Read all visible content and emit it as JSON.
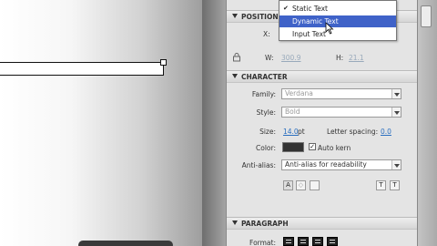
{
  "properties": {
    "position_section": "POSITION",
    "x_label": "X:",
    "w_label": "W:",
    "w_value": "300.9",
    "h_label": "H:",
    "h_value": "21.1",
    "character_section": "CHARACTER",
    "family_label": "Family:",
    "family_value": "Verdana",
    "style_label": "Style:",
    "style_value": "Bold",
    "size_label": "Size:",
    "size_value": "14.0",
    "size_unit": "pt",
    "letter_spacing_label": "Letter spacing:",
    "letter_spacing_value": "0.0",
    "color_label": "Color:",
    "color_value": "#333333",
    "auto_kern_label": "Auto kern",
    "auto_kern_checked": true,
    "anti_alias_label": "Anti-alias:",
    "anti_alias_value": "Anti-alias for readability",
    "paragraph_section": "PARAGRAPH",
    "format_label": "Format:"
  },
  "text_type_menu": {
    "items": [
      "Static Text",
      "Dynamic Text",
      "Input Text"
    ],
    "checked": "Static Text",
    "highlighted": "Dynamic Text"
  },
  "icons": {
    "lock": "lock-icon",
    "cursor": "arrow-cursor-icon"
  }
}
